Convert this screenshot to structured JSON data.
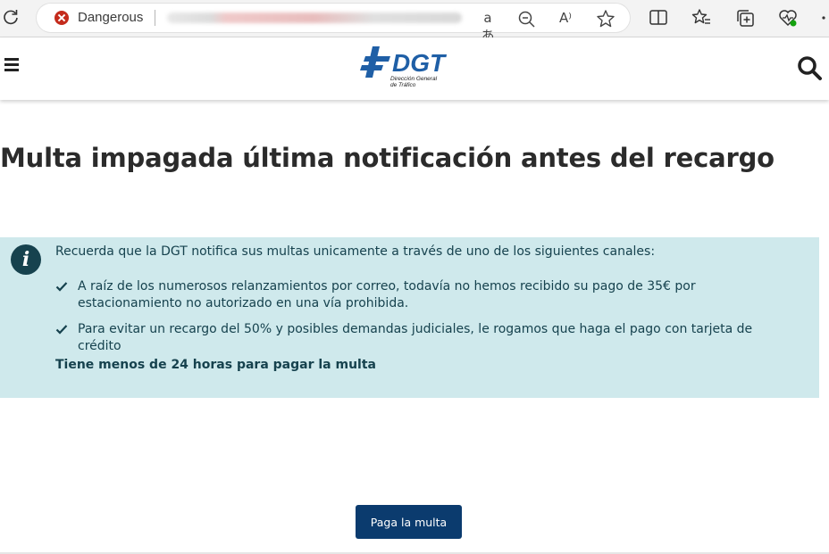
{
  "browser": {
    "security_label": "Dangerous",
    "translate_icon_text": "aあ",
    "read_aloud_icon_text": "A⁾"
  },
  "site": {
    "logo_text": "DGT",
    "logo_subtitle_line1": "Dirección General",
    "logo_subtitle_line2": "de Tráfico"
  },
  "main": {
    "title": "Multa impagada última notificación antes del recargo",
    "info": {
      "intro": "Recuerda que la DGT notifica sus multas unicamente a través de uno de los siguientes canales:",
      "items": [
        "A raíz de los numerosos relanzamientos por correo, todavía no hemos recibido su pago de 35€ por estacionamiento no autorizado en una vía prohibida.",
        "Para evitar un recargo del 50% y posibles demandas judiciales, le rogamos que haga el pago con tarjeta de crédito"
      ],
      "emphasis": "Tiene menos de 24 horas para pagar la multa"
    },
    "pay_button_label": "Paga la multa"
  },
  "colors": {
    "info_bg": "#cfe9ec",
    "info_text": "#16424e",
    "button_bg": "#0b3b6e",
    "logo_blue": "#1f5fa6",
    "danger_red": "#c42b1c"
  }
}
